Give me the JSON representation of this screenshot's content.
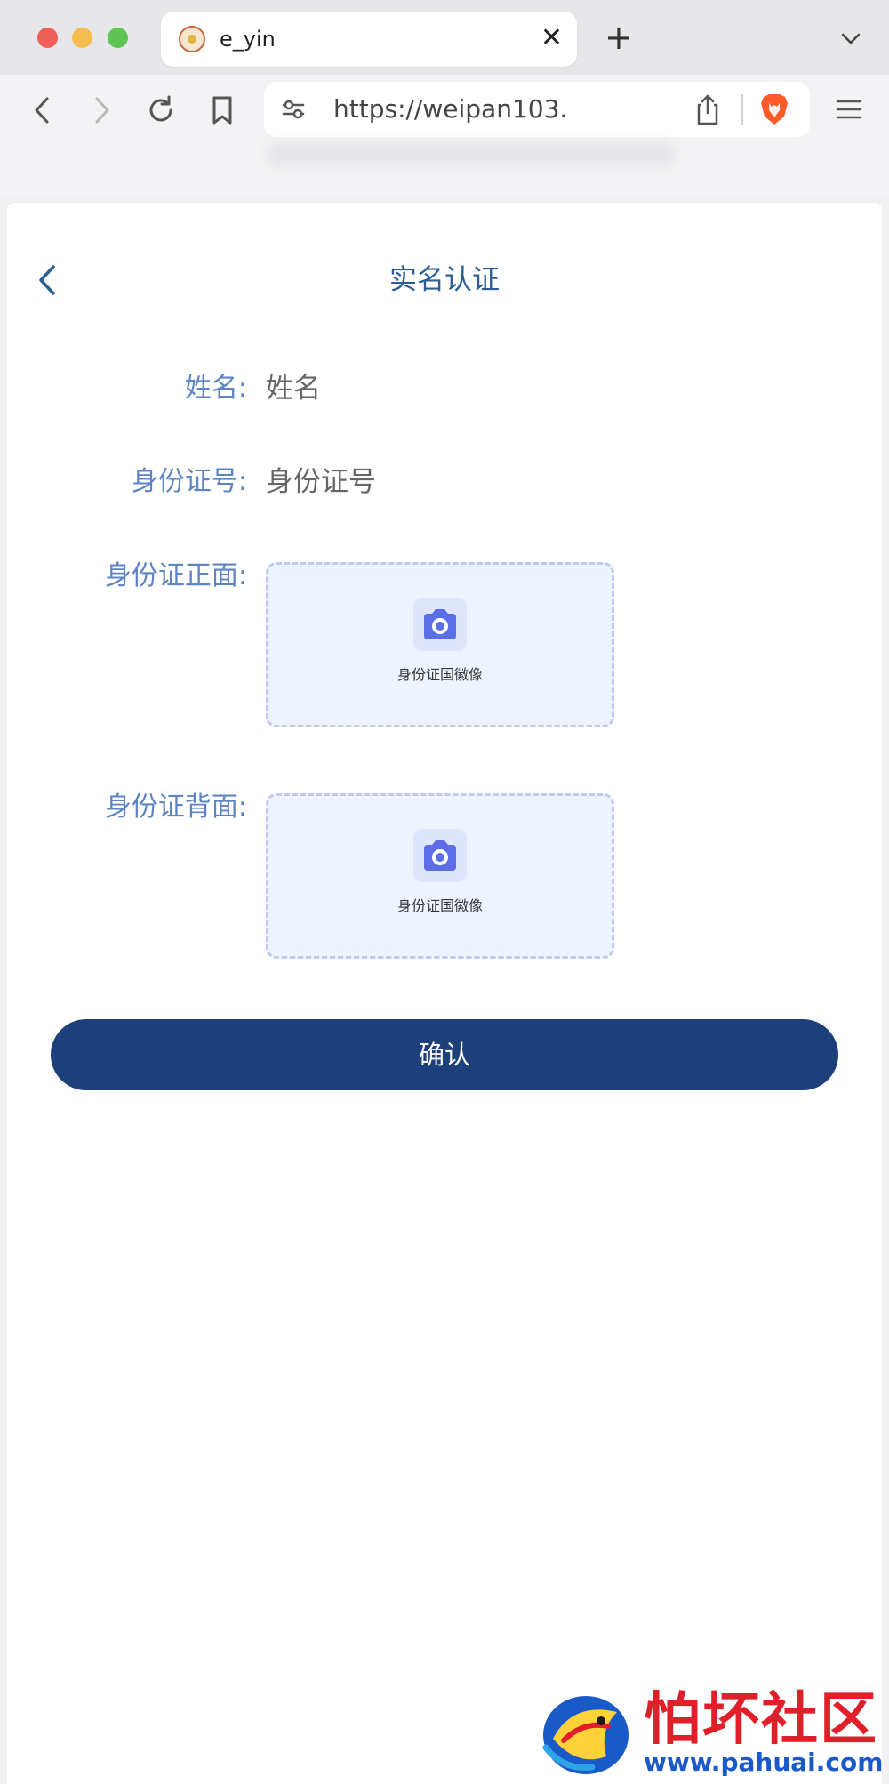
{
  "browser": {
    "tab_title": "e_yin",
    "close_glyph": "✕",
    "new_tab_glyph": "+",
    "url": "https://weipan103.",
    "icons": [
      "back-arrow-icon",
      "forward-arrow-icon",
      "reload-icon",
      "bookmark-icon",
      "site-settings-icon",
      "share-icon",
      "brave-shield-icon",
      "menu-icon",
      "tab-list-chevron-icon"
    ]
  },
  "page": {
    "title": "实名认证",
    "fields": {
      "name": {
        "label": "姓名:",
        "placeholder": "姓名"
      },
      "id_number": {
        "label": "身份证号:",
        "placeholder": "身份证号"
      },
      "id_front": {
        "label": "身份证正面:",
        "upload_text": "身份证国徽像"
      },
      "id_back": {
        "label": "身份证背面:",
        "upload_text": "身份证国徽像"
      }
    },
    "confirm_label": "确认"
  },
  "watermark": {
    "title": "怕坏社区",
    "url": "www.pahuai.com"
  },
  "colors": {
    "title": "#2b5d93",
    "label": "#5f84c4",
    "button": "#1d3f7a",
    "upload_bg": "#eef4ff",
    "camera": "#5b6ee8"
  }
}
